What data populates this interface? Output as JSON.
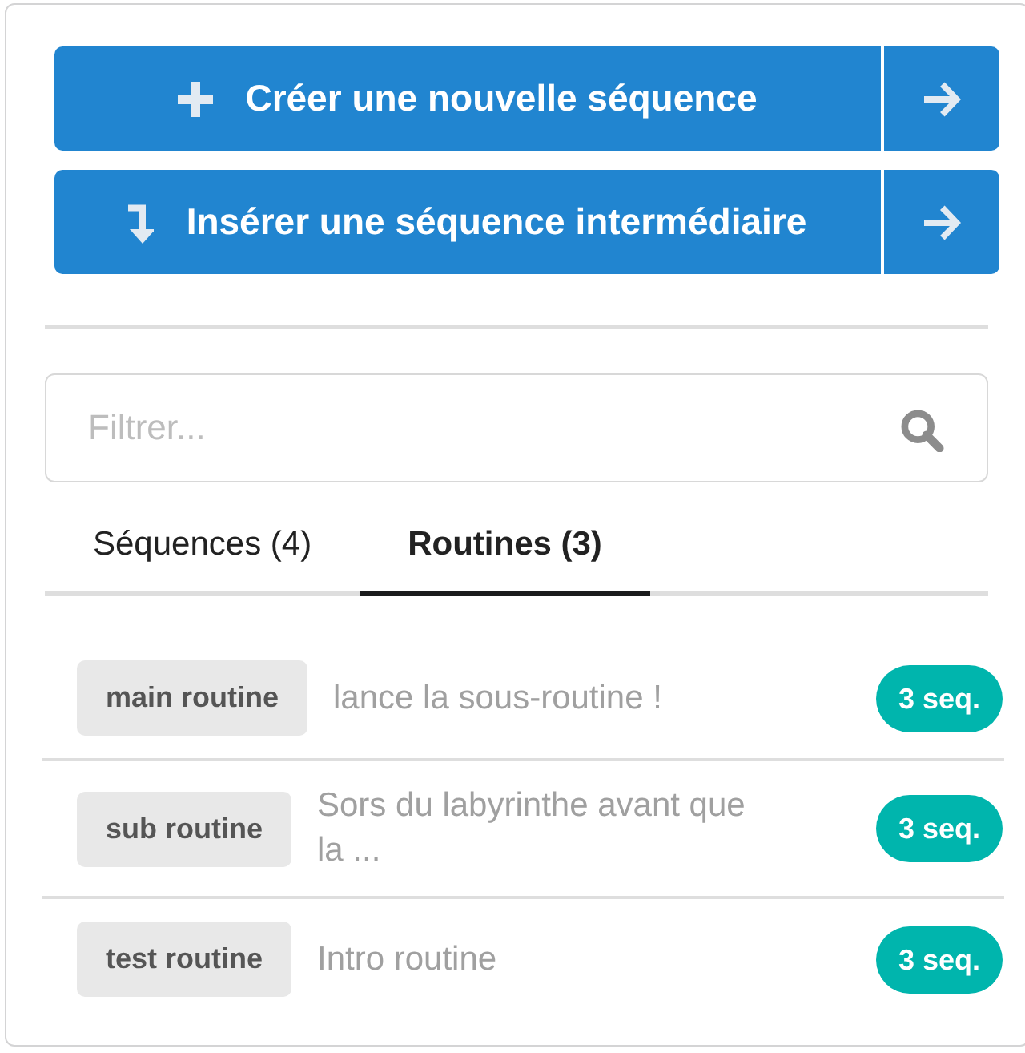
{
  "actions": [
    {
      "kind": "create",
      "label": "Créer une nouvelle séquence"
    },
    {
      "kind": "insert",
      "label": "Insérer une séquence intermédiaire"
    }
  ],
  "filter": {
    "placeholder": "Filtrer..."
  },
  "tabs": [
    {
      "label": "Séquences (4)",
      "selected": false
    },
    {
      "label": "Routines (3)",
      "selected": true
    }
  ],
  "routines": [
    {
      "name": "main routine",
      "description": "lance la sous-routine !",
      "count": "3 seq."
    },
    {
      "name": "sub routine",
      "description": "Sors du labyrinthe avant que la ...",
      "count": "3 seq."
    },
    {
      "name": "test routine",
      "description": "Intro routine",
      "count": "3 seq."
    }
  ]
}
